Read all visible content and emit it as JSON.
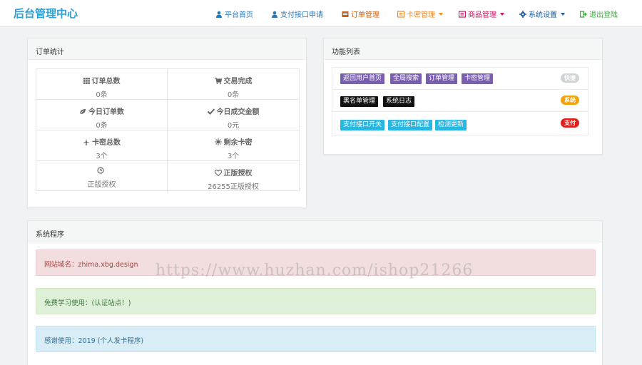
{
  "header": {
    "brand": "后台管理中心",
    "nav": [
      {
        "label": "平台首页",
        "icon": "user-icon",
        "color": "#2a7ab5"
      },
      {
        "label": "支付接口申请",
        "icon": "user-icon",
        "color": "#2a7ab5"
      },
      {
        "label": "订单管理",
        "icon": "list-icon",
        "color": "#c0621c"
      },
      {
        "label": "卡密管理",
        "icon": "list-icon",
        "color": "#f08b2c"
      },
      {
        "label": "商品管理",
        "icon": "list-icon",
        "color": "#c2185b"
      },
      {
        "label": "系统设置",
        "icon": "gear-icon",
        "color": "#1e5fa8"
      },
      {
        "label": "退出登陆",
        "icon": "logout-icon",
        "color": "#3ca93c"
      }
    ]
  },
  "order_stats": {
    "title": "订单统计",
    "items": [
      {
        "label": "订单总数",
        "value": "0条",
        "icon": "grid-icon"
      },
      {
        "label": "交易完成",
        "value": "0条",
        "icon": "cart-icon"
      },
      {
        "label": "今日订单数",
        "value": "0条",
        "icon": "leaf-icon"
      },
      {
        "label": "今日成交金额",
        "value": "0元",
        "icon": "check-icon"
      },
      {
        "label": "卡密总数",
        "value": "3个",
        "icon": "plane-icon"
      },
      {
        "label": "剩余卡密",
        "value": "3个",
        "icon": "sun-icon"
      },
      {
        "label": "",
        "value": "正版授权",
        "icon": "clock-icon"
      },
      {
        "label": "正版授权",
        "value": "26255正版授权",
        "icon": "heart-icon"
      }
    ]
  },
  "functions": {
    "title": "功能列表",
    "rows": [
      {
        "tags": [
          "返回用户首页",
          "全局搜索",
          "订单管理",
          "卡密管理"
        ],
        "tag_color": "#7a5fb0",
        "pill": "快捷",
        "pill_color": "#cfd4d6"
      },
      {
        "tags": [
          "黑名单管理",
          "系统日志"
        ],
        "tag_color": "#111111",
        "pill": "系统",
        "pill_color": "#f0a30a"
      },
      {
        "tags": [
          "支付接口开关",
          "支付接口配置",
          "检测更新"
        ],
        "tag_color": "#29b6e0",
        "pill": "支付",
        "pill_color": "#e0201b"
      }
    ]
  },
  "system": {
    "title": "系统程序",
    "alerts": [
      {
        "text": "网站域名：zhima.xbg.design",
        "bg": "#f2dede",
        "border": "#ebccd1",
        "color": "#a94442"
      },
      {
        "text": "免费学习使用：(认证站点！)",
        "bg": "#dff0d8",
        "border": "#d6e9c6",
        "color": "#3c763d"
      },
      {
        "text": "感谢使用：2019 (个人发卡程序)",
        "bg": "#d9edf7",
        "border": "#bce8f1",
        "color": "#31708f"
      }
    ]
  },
  "watermark": "https://www.huzhan.com/ishop21266"
}
